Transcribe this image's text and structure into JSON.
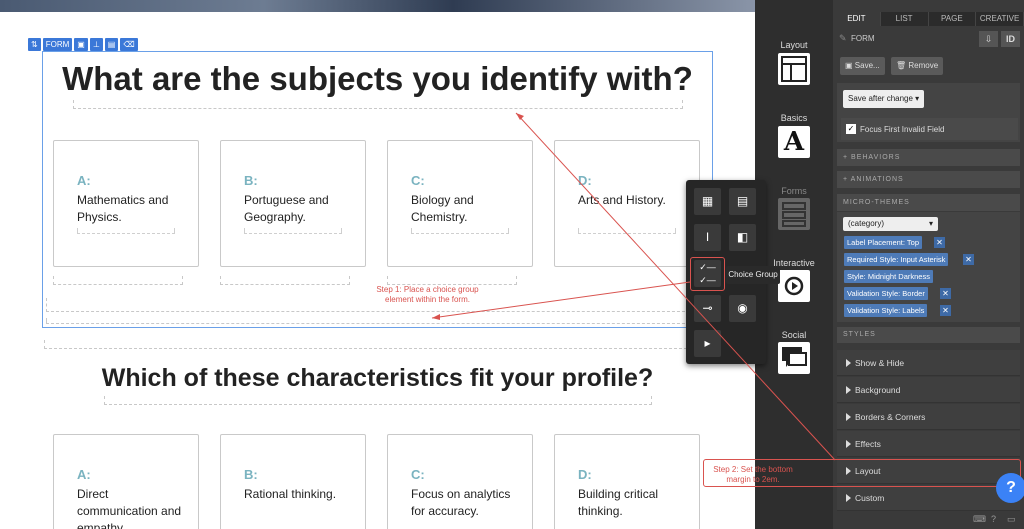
{
  "canvas": {
    "toolbar": {
      "label": "FORM"
    },
    "question1": "What are the subjects you identify with?",
    "question2": "Which of these characteristics fit your profile?",
    "cards1": [
      {
        "letter": "A:",
        "text": "Mathematics and Physics."
      },
      {
        "letter": "B:",
        "text": "Portuguese and Geography."
      },
      {
        "letter": "C:",
        "text": "Biology and Chemistry."
      },
      {
        "letter": "D:",
        "text": "Arts and History."
      }
    ],
    "cards2": [
      {
        "letter": "A:",
        "text": "Direct communication and empathy."
      },
      {
        "letter": "B:",
        "text": "Rational thinking."
      },
      {
        "letter": "C:",
        "text": "Focus on analytics for accuracy."
      },
      {
        "letter": "D:",
        "text": "Building critical thinking."
      }
    ]
  },
  "categories": {
    "layout": "Layout",
    "basics": "Basics",
    "forms": "Forms",
    "interactive": "Interactive",
    "social": "Social"
  },
  "flyout": {
    "tooltip": "Choice Group"
  },
  "annotations": {
    "step1": "Step 1: Place a choice group element within the form.",
    "step2": "Step 2: Set the bottom margin to 2em.",
    "color": "#d9534f"
  },
  "panel": {
    "tabs": [
      "EDIT",
      "LIST",
      "PAGE",
      "CREATIVE"
    ],
    "element_title": "FORM",
    "id_label": "ID",
    "save_button": "Save...",
    "remove_button": "Remove",
    "save_after_change": "Save after change",
    "focus_first_invalid": "Focus First Invalid Field",
    "behaviors": "+ BEHAVIORS",
    "animations": "+ ANIMATIONS",
    "micro_themes": "MICRO-THEMES",
    "category_select": "(category)",
    "chips": [
      "Label Placement: Top",
      "Required Style: Input Asterisk",
      "Style: Midnight Darkness",
      "Validation Style: Border",
      "Validation Style: Labels"
    ],
    "styles_head": "STYLES",
    "style_rows": [
      "Show & Hide",
      "Background",
      "Borders & Corners",
      "Effects",
      "Layout",
      "Custom"
    ],
    "help_label": "?"
  }
}
